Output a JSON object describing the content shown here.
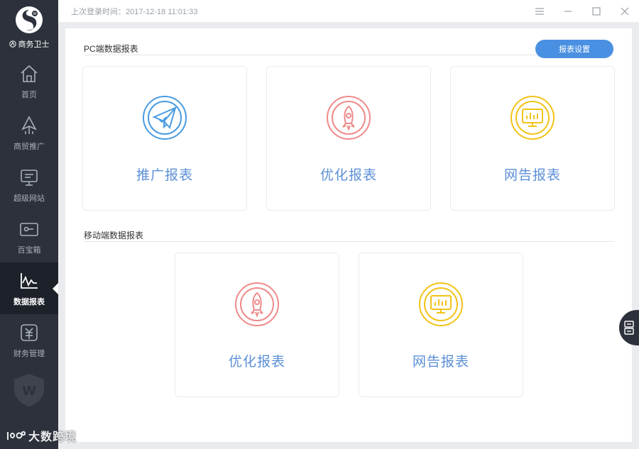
{
  "brand": {
    "name": "商务卫士"
  },
  "sidebar": {
    "items": [
      {
        "label": "首页",
        "icon": "home-icon"
      },
      {
        "label": "商贸推广",
        "icon": "promotion-icon"
      },
      {
        "label": "超级网站",
        "icon": "website-icon"
      },
      {
        "label": "百宝箱",
        "icon": "toolbox-icon"
      },
      {
        "label": "数据报表",
        "icon": "chart-icon",
        "active": true
      },
      {
        "label": "财务管理",
        "icon": "finance-icon"
      }
    ]
  },
  "titlebar": {
    "last_login": "上次登录时间：2017-12-18 11:01:33"
  },
  "pc_section": {
    "title": "PC端数据报表",
    "settings_button": "报表设置",
    "cards": [
      {
        "title": "推广报表",
        "icon": "paper-plane-icon",
        "color": "#4a9be0"
      },
      {
        "title": "优化报表",
        "icon": "rocket-icon",
        "color": "#ef8a8a"
      },
      {
        "title": "网告报表",
        "icon": "monitor-icon",
        "color": "#f2c318"
      }
    ]
  },
  "mobile_section": {
    "title": "移动端数据报表",
    "cards": [
      {
        "title": "优化报表",
        "icon": "rocket-icon",
        "color": "#ef8a8a"
      },
      {
        "title": "网告报表",
        "icon": "monitor-icon",
        "color": "#f2c318"
      }
    ]
  },
  "watermark": {
    "text": "大数跨境"
  },
  "colors": {
    "sidebar_bg": "#2c313b",
    "accent": "#4a90e2",
    "card_title": "#5b8fd6"
  }
}
